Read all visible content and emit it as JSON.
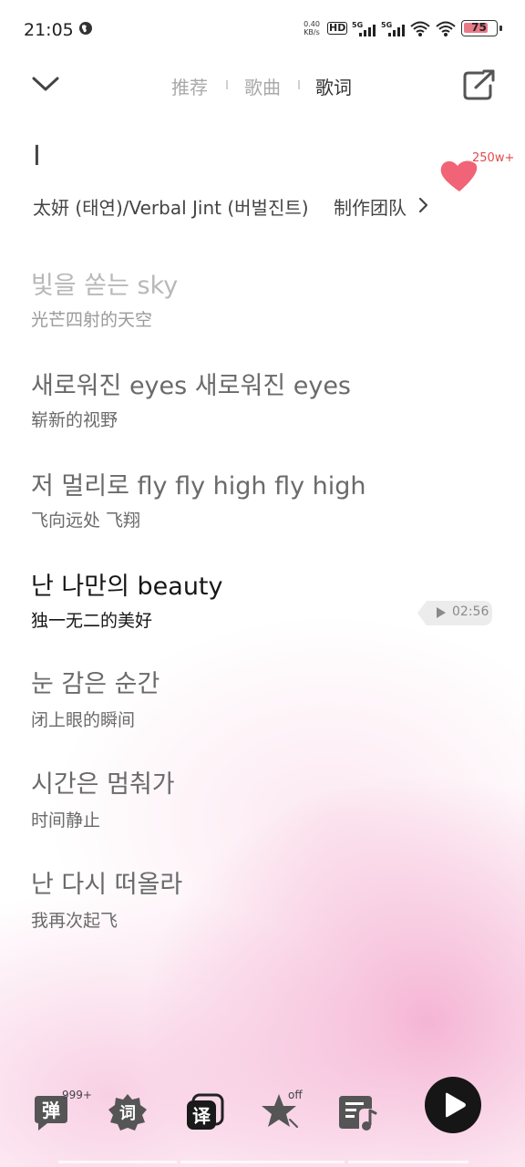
{
  "status_bar": {
    "time": "21:05",
    "speed_value": "0.40",
    "speed_unit": "KB/s",
    "hd_label": "HD",
    "net1": "5G",
    "net2": "5G",
    "battery": "75",
    "battery_color": "#e87a88"
  },
  "header": {
    "tabs": [
      {
        "label": "推荐"
      },
      {
        "label": "歌曲"
      },
      {
        "label": "歌词"
      }
    ],
    "active_tab": "歌词"
  },
  "song": {
    "title": "I",
    "artist": "太妍 (태연)/Verbal Jint (버벌진트)",
    "credits_label": "制作团队",
    "like_count": "250w+",
    "like_color": "#f0566a"
  },
  "lyrics": [
    {
      "original": "빛을 쏟는 sky",
      "translation": "光芒四射的天空"
    },
    {
      "original": "새로워진 eyes 새로워진 eyes",
      "translation": "崭新的视野"
    },
    {
      "original": "저 멀리로 fly fly high fly high",
      "translation": "飞向远处 飞翔"
    },
    {
      "original": "난 나만의 beauty",
      "translation": "独一无二的美好"
    },
    {
      "original": "눈 감은 순간",
      "translation": "闭上眼的瞬间"
    },
    {
      "original": "시간은 멈춰가",
      "translation": "时间静止"
    },
    {
      "original": "난 다시 떠올라",
      "translation": "我再次起飞"
    }
  ],
  "seek_time": "02:56",
  "toolbar": {
    "danmu_label": "弹",
    "danmu_count": "999+",
    "lyric_label": "词",
    "translate_label": "译",
    "favorite_state": "off"
  },
  "icons": [
    "globe-icon",
    "chevron-down-icon",
    "share-icon",
    "heart-icon",
    "play-icon",
    "playlist-icon",
    "star-icon"
  ]
}
